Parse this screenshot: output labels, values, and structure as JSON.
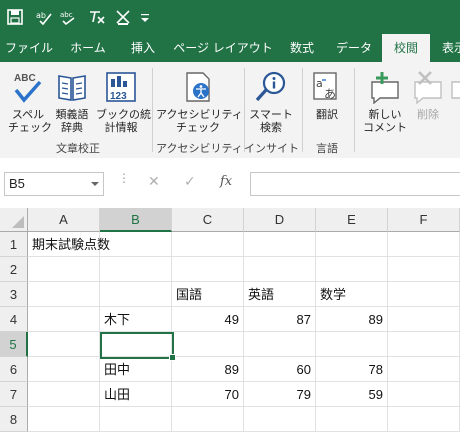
{
  "qat": {
    "icons": [
      "save-icon",
      "spelling-check-icon",
      "abc-check-icon",
      "clear-formatting-icon",
      "highlight-icon",
      "customize-qat-icon"
    ]
  },
  "tabs": [
    {
      "label": "ファイル",
      "active": false
    },
    {
      "label": "ホーム",
      "active": false
    },
    {
      "label": "挿入",
      "active": false
    },
    {
      "label": "ページ レイアウト",
      "active": false
    },
    {
      "label": "数式",
      "active": false
    },
    {
      "label": "データ",
      "active": false
    },
    {
      "label": "校閲",
      "active": true
    },
    {
      "label": "表示",
      "active": false
    }
  ],
  "ribbon": {
    "spell_line1": "スペル",
    "spell_line2": "チェック",
    "thesaurus_line1": "類義語",
    "thesaurus_line2": "辞典",
    "workbook_stats_line1": "ブックの統",
    "workbook_stats_line2": "計情報",
    "accessibility_line1": "アクセシビリティ",
    "accessibility_line2": "チェック",
    "smart_lookup_line1": "スマート",
    "smart_lookup_line2": "検索",
    "translate_label": "翻訳",
    "new_comment_line1": "新しい",
    "new_comment_line2": "コメント",
    "delete_label": "削除",
    "groups": {
      "proofing": "文章校正",
      "accessibility": "アクセシビリティ",
      "insights": "インサイト",
      "language": "言語"
    }
  },
  "formula_bar": {
    "name_box": "B5",
    "fx": "fx",
    "formula": ""
  },
  "grid": {
    "columns": [
      "A",
      "B",
      "C",
      "D",
      "E",
      "F"
    ],
    "selected_column": "B",
    "rows": [
      "1",
      "2",
      "3",
      "4",
      "5",
      "6",
      "7",
      "8"
    ],
    "selected_row": "5",
    "cells": {
      "A1": "期末試験点数",
      "C3": "国語",
      "D3": "英語",
      "E3": "数学",
      "B4": "木下",
      "C4": "49",
      "D4": "87",
      "E4": "89",
      "B6": "田中",
      "C6": "89",
      "D6": "60",
      "E6": "78",
      "B7": "山田",
      "C7": "70",
      "D7": "79",
      "E7": "59"
    }
  },
  "colors": {
    "brand": "#217346",
    "ribbon_bg": "#f3f3f3",
    "header_bg": "#efefef"
  }
}
